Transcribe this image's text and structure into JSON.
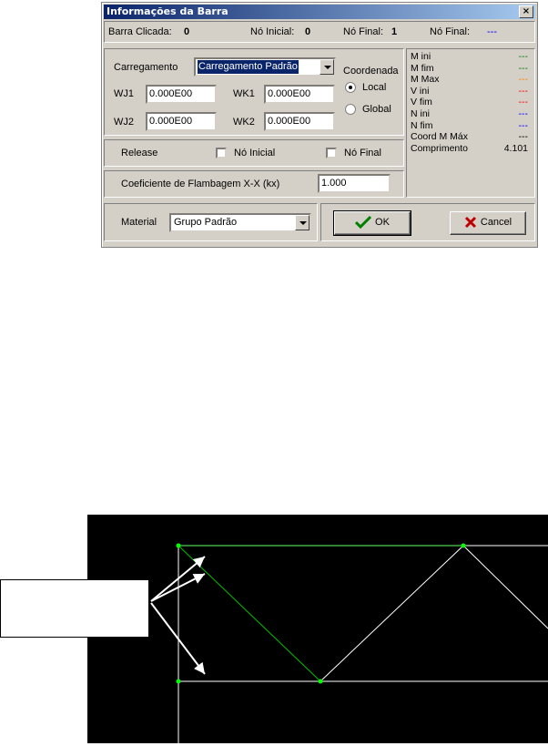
{
  "dialog": {
    "title": "Informações da Barra",
    "close_glyph": "×",
    "info": {
      "barra_clicada_label": "Barra Clicada:",
      "barra_clicada_value": "0",
      "no_inicial_label": "Nó Inicial:",
      "no_inicial_value": "0",
      "no_final_label": "Nó Final:",
      "no_final_value": "1",
      "no_final2_label": "Nó Final:",
      "no_final2_value": "---"
    },
    "carregamento": {
      "label": "Carregamento",
      "selected": "Carregamento Padrão",
      "wj1_label": "WJ1",
      "wj1_value": "0.000E00",
      "wk1_label": "WK1",
      "wk1_value": "0.000E00",
      "wj2_label": "WJ2",
      "wj2_value": "0.000E00",
      "wk2_label": "WK2",
      "wk2_value": "0.000E00"
    },
    "coordenada": {
      "label": "Coordenada",
      "local_label": "Local",
      "global_label": "Global",
      "selected": "Local"
    },
    "release": {
      "label": "Release",
      "no_inicial_label": "Nó Inicial",
      "no_final_label": "Nó Final",
      "no_inicial_checked": false,
      "no_final_checked": false
    },
    "flambagem": {
      "label": "Coeficiente de Flambagem X-X (kx)",
      "value": "1.000"
    },
    "material": {
      "label": "Material",
      "selected": "Grupo Padrão"
    },
    "buttons": {
      "ok_label": "OK",
      "cancel_label": "Cancel"
    },
    "results": [
      {
        "label": "M ini",
        "value": "---",
        "color": "#008000"
      },
      {
        "label": "M fim",
        "value": "---",
        "color": "#008000"
      },
      {
        "label": "M Max",
        "value": "---",
        "color": "#ff8000"
      },
      {
        "label": "V ini",
        "value": "---",
        "color": "#ff0000"
      },
      {
        "label": "V fim",
        "value": "---",
        "color": "#ff0000"
      },
      {
        "label": "N ini",
        "value": "---",
        "color": "#0000ff"
      },
      {
        "label": "N fim",
        "value": "---",
        "color": "#0000ff"
      },
      {
        "label": "Coord M Máx",
        "value": "---",
        "color": "#000000"
      },
      {
        "label": "Comprimento",
        "value": "4.101",
        "color": "#000000"
      }
    ]
  },
  "colors": {
    "face": "#d4d0c8",
    "title_bar": "#0a246a",
    "canvas": "#000000",
    "structure_line": "#ffffff",
    "selected_member": "#00ff00",
    "node": "#00ff00"
  }
}
